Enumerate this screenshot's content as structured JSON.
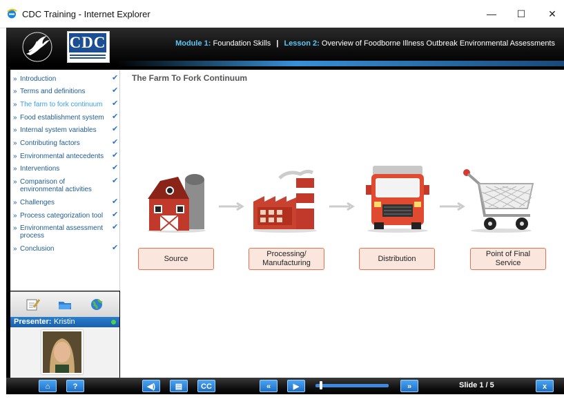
{
  "window": {
    "title": "CDC Training - Internet Explorer",
    "minimize": "—",
    "maximize": "☐",
    "close": "✕"
  },
  "header": {
    "logo_text": "CDC",
    "module_label": "Module 1:",
    "module_name": "Foundation Skills",
    "separator": "|",
    "lesson_label": "Lesson 2:",
    "lesson_name": "Overview of Foodborne Illness Outbreak Environmental Assessments"
  },
  "sidebar": {
    "items": [
      {
        "label": "Introduction",
        "checked": true,
        "active": false
      },
      {
        "label": "Terms and definitions",
        "checked": true,
        "active": false
      },
      {
        "label": "The farm to fork continuum",
        "checked": true,
        "active": true
      },
      {
        "label": "Food establishment system",
        "checked": true,
        "active": false
      },
      {
        "label": "Internal system variables",
        "checked": true,
        "active": false
      },
      {
        "label": "Contributing factors",
        "checked": true,
        "active": false
      },
      {
        "label": "Environmental antecedents",
        "checked": true,
        "active": false
      },
      {
        "label": "Interventions",
        "checked": true,
        "active": false
      },
      {
        "label": "Comparison of environmental activities",
        "checked": true,
        "active": false
      },
      {
        "label": "Challenges",
        "checked": true,
        "active": false
      },
      {
        "label": "Process categorization tool",
        "checked": true,
        "active": false
      },
      {
        "label": "Environmental assessment process",
        "checked": true,
        "active": false
      },
      {
        "label": "Conclusion",
        "checked": true,
        "active": false
      }
    ],
    "bullet": "»",
    "check": "✔",
    "tools": [
      "notes-icon",
      "folder-icon",
      "globe-icon"
    ]
  },
  "presenter": {
    "label": "Presenter:",
    "name": "Kristin",
    "status_color": "#4cd14a"
  },
  "slide": {
    "title": "The Farm To Fork Continuum",
    "stages": [
      {
        "label": "Source",
        "icon": "barn-icon"
      },
      {
        "label": "Processing/ Manufacturing",
        "icon": "factory-icon"
      },
      {
        "label": "Distribution",
        "icon": "truck-icon"
      },
      {
        "label": "Point of Final Service",
        "icon": "shopping-cart-icon"
      }
    ]
  },
  "controls": {
    "home": "⌂",
    "help": "?",
    "audio": "◀)",
    "transcript": "▤",
    "cc": "CC",
    "prev": "«",
    "play": "▶",
    "next": "»",
    "slide_counter": "Slide 1 / 5",
    "exit": "x",
    "progress": 0.06
  },
  "colors": {
    "accent": "#1f6fc4",
    "stage_border": "#e8704e",
    "stage_fill": "#fbe6de",
    "nav_text": "#1e5b92"
  }
}
